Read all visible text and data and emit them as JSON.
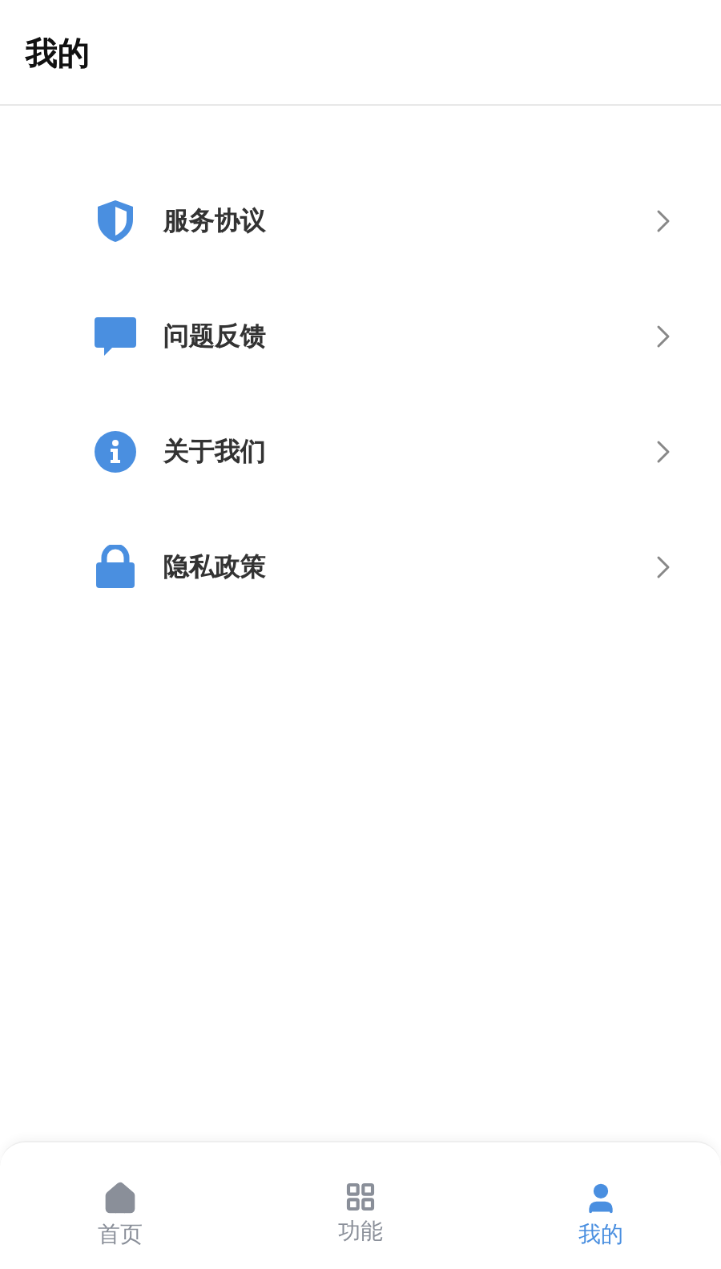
{
  "header": {
    "title": "我的"
  },
  "menu": [
    {
      "label": "服务协议"
    },
    {
      "label": "问题反馈"
    },
    {
      "label": "关于我们"
    },
    {
      "label": "隐私政策"
    }
  ],
  "tabbar": [
    {
      "label": "首页",
      "selected": false
    },
    {
      "label": "功能",
      "selected": false
    },
    {
      "label": "我的",
      "selected": true
    }
  ]
}
